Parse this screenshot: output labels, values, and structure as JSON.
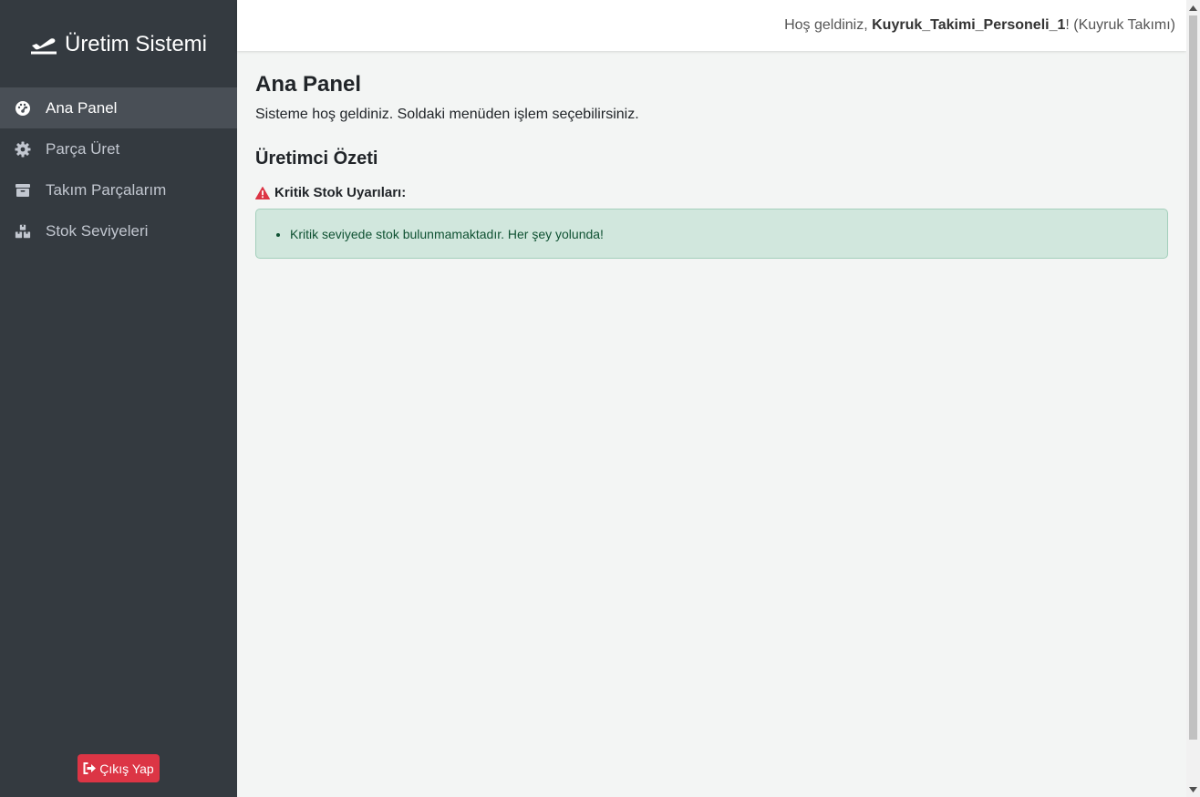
{
  "sidebar": {
    "brand": "Üretim Sistemi",
    "brand_icon": "plane-departure-icon",
    "items": [
      {
        "label": "Ana Panel",
        "icon": "tachometer-icon",
        "active": true
      },
      {
        "label": "Parça Üret",
        "icon": "gear-icon",
        "active": false
      },
      {
        "label": "Takım Parçalarım",
        "icon": "archive-box-icon",
        "active": false
      },
      {
        "label": "Stok Seviyeleri",
        "icon": "cubes-icon",
        "active": false
      }
    ],
    "logout_label": "Çıkış Yap"
  },
  "header": {
    "welcome_prefix": "Hoş geldiniz, ",
    "username": "Kuyruk_Takimi_Personeli_1",
    "team_suffix": "! (Kuyruk Takımı)"
  },
  "main": {
    "title": "Ana Panel",
    "intro": "Sisteme hoş geldiniz. Soldaki menüden işlem seçebilirsiniz.",
    "section_title": "Üretimci Özeti",
    "alert_heading": "Kritik Stok Uyarıları:",
    "alert_items": [
      "Kritik seviyede stok bulunmamaktadır. Her şey yolunda!"
    ]
  },
  "colors": {
    "sidebar_bg": "#343a40",
    "active_item_bg": "#494f56",
    "danger": "#dc3545",
    "success_bg": "#d1e7dd",
    "success_text": "#0f5132"
  }
}
